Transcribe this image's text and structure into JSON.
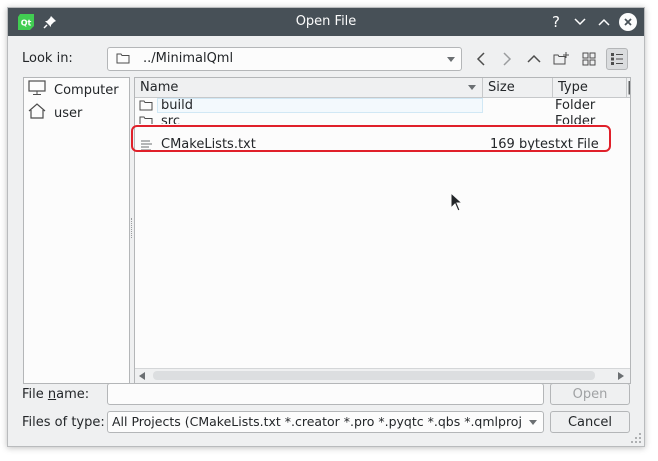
{
  "window": {
    "title": "Open File"
  },
  "toolbar": {
    "look_in_label": "Look in:",
    "path": "../MinimalQml"
  },
  "sidebar": {
    "items": [
      {
        "label": "Computer",
        "icon": "computer-icon"
      },
      {
        "label": "user",
        "icon": "home-icon"
      }
    ]
  },
  "columns": {
    "name": "Name",
    "size": "Size",
    "type": "Type"
  },
  "files": [
    {
      "name": "build",
      "size": "",
      "type": "Folder",
      "icon": "folder-icon"
    },
    {
      "name": "src",
      "size": "",
      "type": "Folder",
      "icon": "folder-icon"
    },
    {
      "name": "CMakeLists.txt",
      "size": "169 bytes",
      "type": "txt File",
      "icon": "text-file-icon"
    }
  ],
  "filename": {
    "label_pre": "File ",
    "label_u": "n",
    "label_post": "ame:",
    "value": ""
  },
  "filetype": {
    "label": "Files of type:",
    "value": "All Projects (CMakeLists.txt *.creator *.pro *.pyqtc *.qbs *.qmlprojec…"
  },
  "buttons": {
    "open": "Open",
    "cancel": "Cancel"
  },
  "colors": {
    "titlebar": "#475057",
    "highlight": "#e0202a",
    "accent": "#3daee9"
  }
}
